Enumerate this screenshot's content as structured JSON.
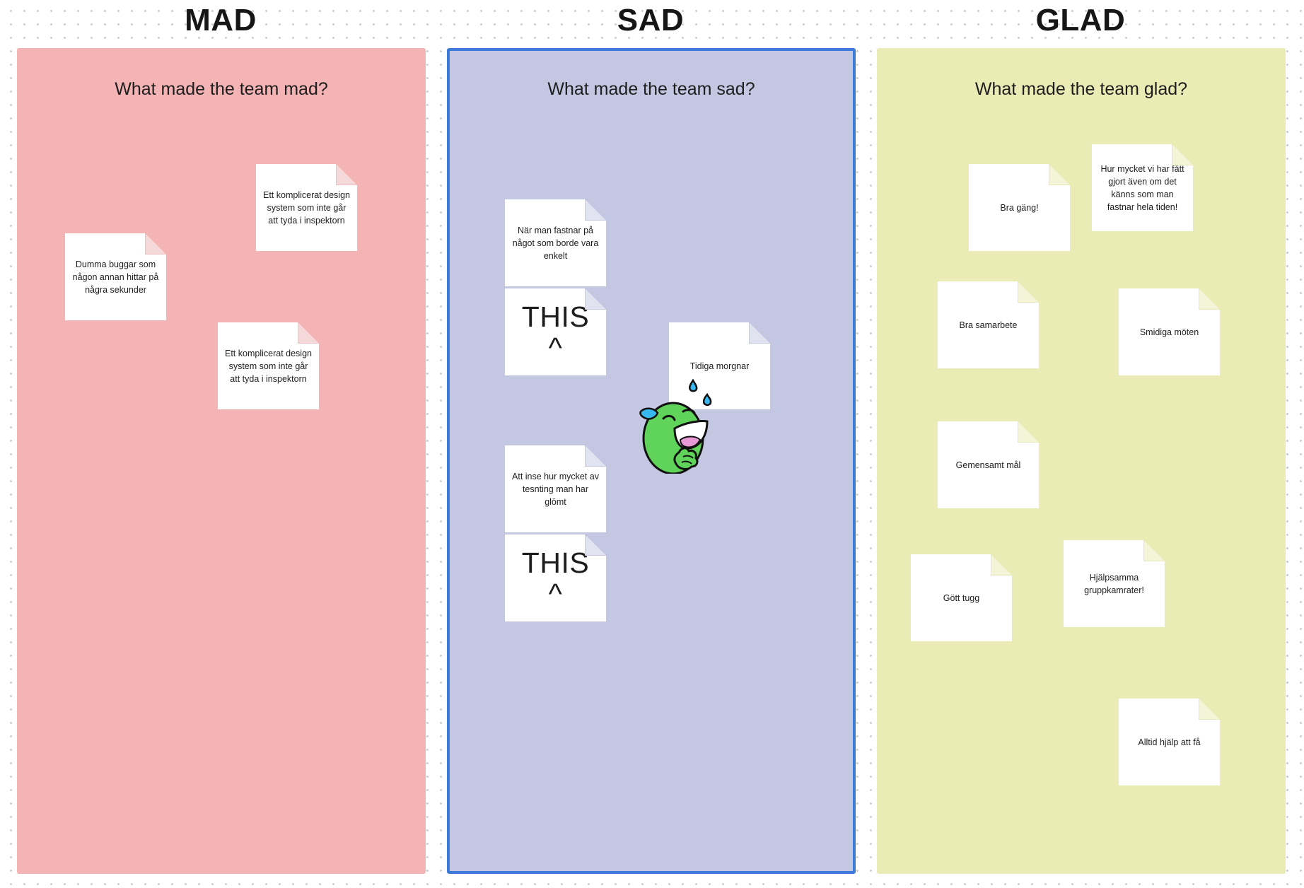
{
  "board": {
    "columns": [
      {
        "heading": "MAD",
        "prompt": "What made the team mad?",
        "color": "#f4b3b4",
        "selected": false,
        "notes": [
          "Ett komplicerat design system som inte går att tyda i inspektorn",
          "Dumma buggar som någon annan hittar på några sekunder",
          "Ett komplicerat design system som inte går att tyda i inspektorn"
        ]
      },
      {
        "heading": "SAD",
        "prompt": "What made the team sad?",
        "color": "#c4c7e2",
        "selected": true,
        "selection_color": "#3d7bd9",
        "notes": [
          "När man fastnar på något som borde vara enkelt",
          "THIS ^",
          "Tidiga morgnar",
          "Att inse hur mycket av tesnting man har glömt",
          "THIS ^"
        ],
        "sticker": "crying-laughing-face-sticker"
      },
      {
        "heading": "GLAD",
        "prompt": "What made the team glad?",
        "color": "#eaebb5",
        "selected": false,
        "notes": [
          "Bra gäng!",
          "Hur mycket vi har fått gjort även om det känns som man fastnar hela tiden!",
          "Bra samarbete",
          "Smidiga möten",
          "Gemensamt mål",
          "Gött tugg",
          "Hjälpsamma gruppkamrater!",
          "Alltid hjälp att få"
        ]
      }
    ]
  }
}
